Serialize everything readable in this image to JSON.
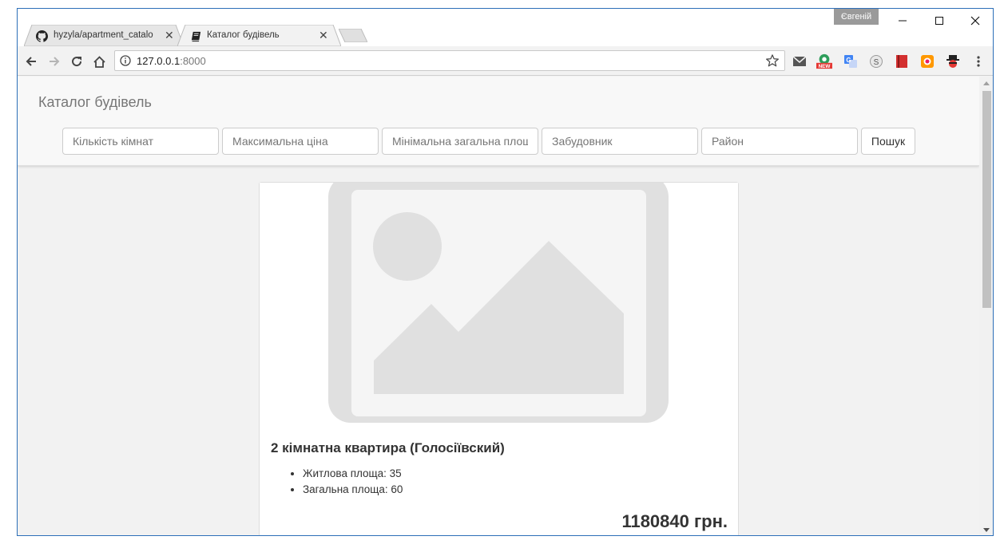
{
  "browser": {
    "tabs": [
      {
        "title": "hyzyla/apartment_catalo",
        "icon": "github-icon",
        "active": false
      },
      {
        "title": "Каталог будівель",
        "icon": "book-icon",
        "active": true
      }
    ],
    "user_badge": "Євгеній",
    "url_host": "127.0.0.1",
    "url_port": ":8000",
    "extensions": [
      "mail-icon",
      "new-extension-icon",
      "translate-icon",
      "s-extension-icon",
      "book-extension-icon",
      "photo-extension-icon",
      "spy-extension-icon"
    ],
    "accent_color": "#2c6fb8"
  },
  "page": {
    "brand": "Каталог будівель",
    "search": {
      "rooms_placeholder": "Кількість кімнат",
      "max_price_placeholder": "Максимальна ціна",
      "min_area_placeholder": "Мінімальна загальна площа",
      "developer_placeholder": "Забудовник",
      "district_placeholder": "Район",
      "button_label": "Пошук"
    },
    "card": {
      "image": "placeholder-image-icon",
      "title": "2 кімнатна квартира (Голосіївский)",
      "details": [
        "Житлова площа: 35",
        "Загальна площа: 60"
      ],
      "price": "1180840 грн."
    }
  }
}
